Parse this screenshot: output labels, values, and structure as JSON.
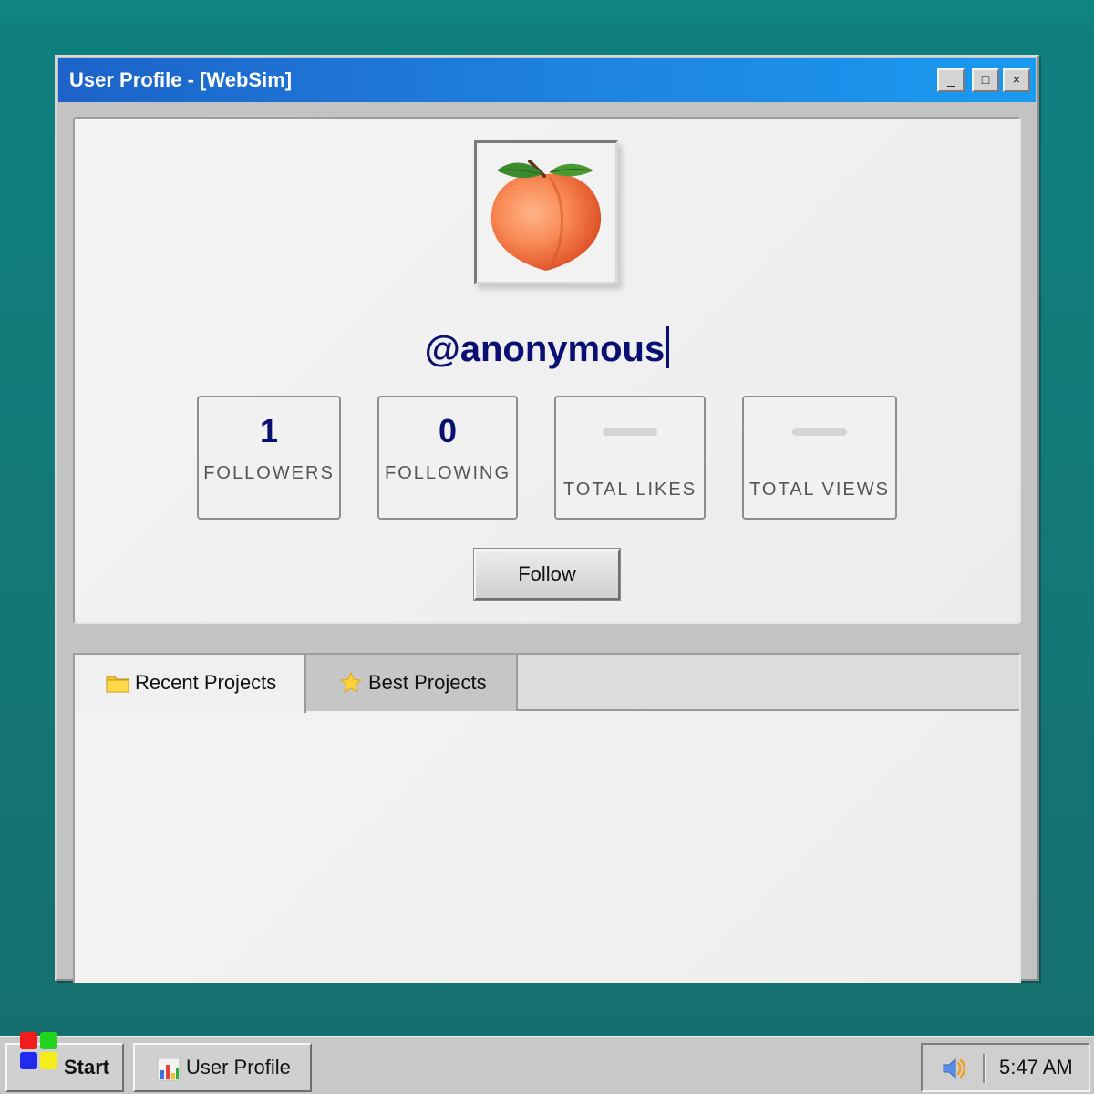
{
  "window": {
    "title": "User Profile - [WebSim]",
    "minimize_label": "_",
    "maximize_label": "□",
    "close_label": "×"
  },
  "profile": {
    "avatar_icon": "peach-icon",
    "username": "@anonymous",
    "stats": [
      {
        "value": "1",
        "label": "FOLLOWERS"
      },
      {
        "value": "0",
        "label": "FOLLOWING"
      },
      {
        "value": "",
        "label": "TOTAL LIKES"
      },
      {
        "value": "",
        "label": "TOTAL VIEWS"
      }
    ],
    "follow_label": "Follow"
  },
  "projects": {
    "tabs": [
      {
        "label": "Recent Projects",
        "icon": "folder-icon",
        "active": true
      },
      {
        "label": "Best Projects",
        "icon": "star-icon",
        "active": false
      }
    ]
  },
  "taskbar": {
    "start_label": "Start",
    "task_label": "User Profile",
    "task_icon": "chart-icon",
    "tray_icon": "speaker-icon",
    "clock": "5:47 AM"
  },
  "colors": {
    "desktop": "#127a79",
    "titlebar": "#1e86e3",
    "username": "#0a0f72"
  }
}
